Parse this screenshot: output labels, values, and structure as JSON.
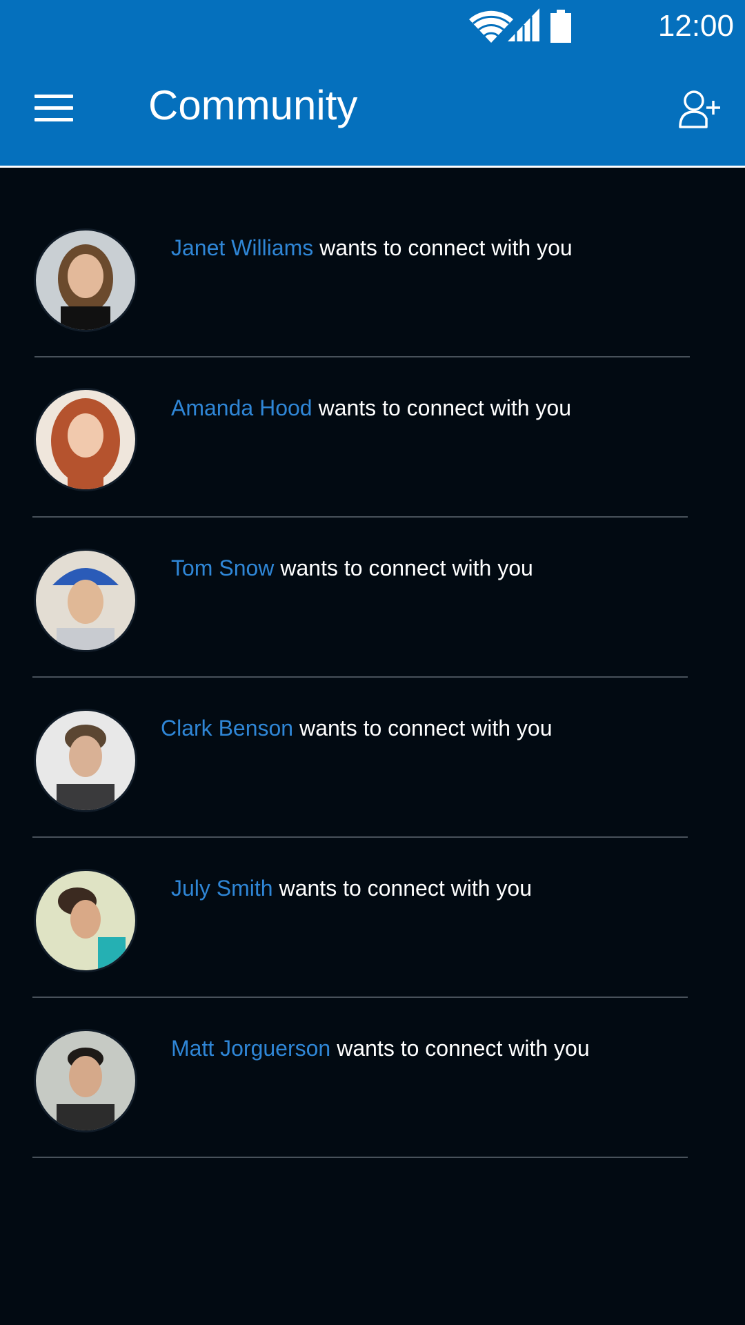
{
  "status_bar": {
    "time": "12:00",
    "icons": [
      "wifi-icon",
      "signal-icon",
      "battery-icon"
    ]
  },
  "app_bar": {
    "title": "Community",
    "menu_icon": "menu-icon",
    "action_icon": "add-user-icon"
  },
  "requests": [
    {
      "name": "Janet Williams",
      "message": "wants to connect with you"
    },
    {
      "name": "Amanda Hood",
      "message": "wants to connect with you"
    },
    {
      "name": "Tom Snow",
      "message": "wants to connect with you"
    },
    {
      "name": "Clark Benson",
      "message": "wants to connect with you"
    },
    {
      "name": "July Smith",
      "message": "wants to connect with you"
    },
    {
      "name": "Matt Jorguerson",
      "message": "wants to connect with you"
    }
  ],
  "colors": {
    "app_bar": "#0570bd",
    "background": "#020a12",
    "name_link": "#2f86d6",
    "text": "#ffffff",
    "divider": "#48515a"
  }
}
